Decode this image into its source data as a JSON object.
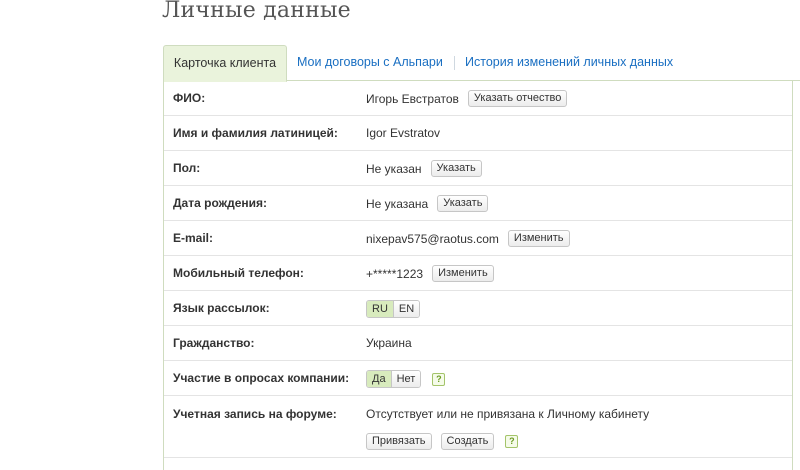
{
  "page": {
    "title": "Личные данные"
  },
  "tabs": [
    {
      "label": "Карточка клиента"
    },
    {
      "label": "Мои договоры с Альпари"
    },
    {
      "label": "История изменений личных данных"
    }
  ],
  "rows": {
    "fio": {
      "label": "ФИО:",
      "value": "Игорь Евстратов",
      "button": "Указать отчество"
    },
    "latin": {
      "label": "Имя и фамилия латиницей:",
      "value": "Igor Evstratov"
    },
    "gender": {
      "label": "Пол:",
      "value": "Не указан",
      "button": "Указать"
    },
    "birth": {
      "label": "Дата рождения:",
      "value": "Не указана",
      "button": "Указать"
    },
    "email": {
      "label": "E-mail:",
      "value": "nixepav575@raotus.com",
      "button": "Изменить"
    },
    "phone": {
      "label": "Мобильный телефон:",
      "value": "+*****1223",
      "button": "Изменить"
    },
    "language": {
      "label": "Язык рассылок:",
      "options": [
        "RU",
        "EN"
      ],
      "selected": "RU"
    },
    "citizenship": {
      "label": "Гражданство:",
      "value": "Украина"
    },
    "surveys": {
      "label": "Участие в опросах компании:",
      "options": [
        "Да",
        "Нет"
      ],
      "selected": "Да",
      "help": "?"
    },
    "forum": {
      "label": "Учетная запись на форуме:",
      "value": "Отсутствует или не привязана к Личному кабинету",
      "bind_button": "Привязать",
      "create_button": "Создать",
      "help": "?"
    }
  },
  "colors": {
    "accent_green": "#eaf3dc",
    "link_blue": "#1a6fc2",
    "border_green": "#cfdcbf"
  }
}
